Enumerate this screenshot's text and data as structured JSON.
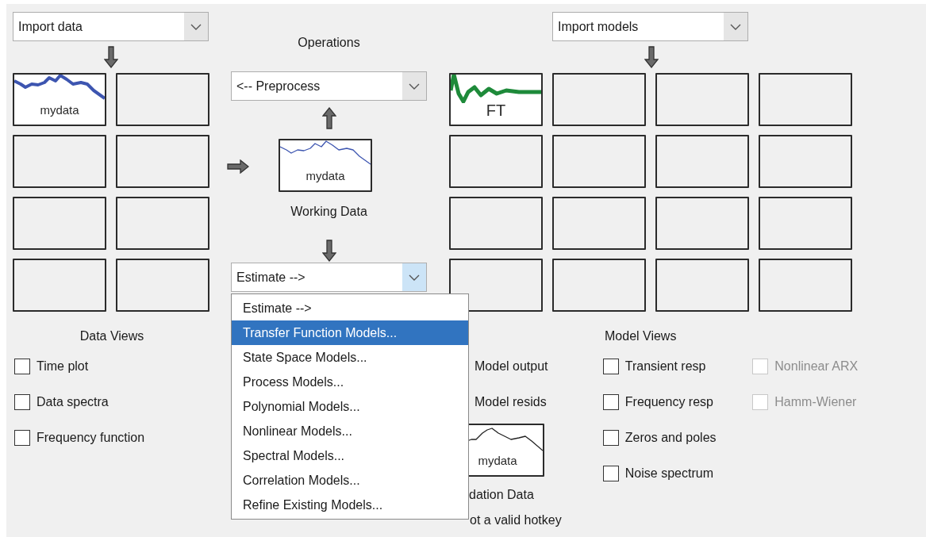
{
  "data_panel": {
    "import_dropdown": "Import data",
    "tiles": [
      {
        "kind": "data",
        "label": "mydata"
      },
      {
        "kind": "empty"
      },
      {
        "kind": "empty"
      },
      {
        "kind": "empty"
      },
      {
        "kind": "empty"
      },
      {
        "kind": "empty"
      },
      {
        "kind": "empty"
      },
      {
        "kind": "empty"
      }
    ],
    "views_title": "Data Views",
    "views": [
      {
        "label": "Time plot",
        "checked": false
      },
      {
        "label": "Data spectra",
        "checked": false
      },
      {
        "label": "Frequency function",
        "checked": false
      }
    ]
  },
  "operations": {
    "title": "Operations",
    "preprocess": "<-- Preprocess",
    "working_data": {
      "label": "mydata",
      "caption": "Working Data"
    },
    "estimate": {
      "value": "Estimate -->",
      "open": true,
      "options": [
        {
          "label": "Estimate -->",
          "highlighted": false
        },
        {
          "label": "Transfer Function Models...",
          "highlighted": true
        },
        {
          "label": "State Space Models...",
          "highlighted": false
        },
        {
          "label": "Process Models...",
          "highlighted": false
        },
        {
          "label": "Polynomial Models...",
          "highlighted": false
        },
        {
          "label": "Nonlinear Models...",
          "highlighted": false
        },
        {
          "label": "Spectral Models...",
          "highlighted": false
        },
        {
          "label": "Correlation Models...",
          "highlighted": false
        },
        {
          "label": "Refine Existing Models...",
          "highlighted": false
        }
      ]
    }
  },
  "model_panel": {
    "import_dropdown": "Import models",
    "tiles": [
      {
        "kind": "model",
        "label": "FT"
      },
      {
        "kind": "empty"
      },
      {
        "kind": "empty"
      },
      {
        "kind": "empty"
      },
      {
        "kind": "empty"
      },
      {
        "kind": "empty"
      },
      {
        "kind": "empty"
      },
      {
        "kind": "empty"
      },
      {
        "kind": "empty"
      },
      {
        "kind": "empty"
      },
      {
        "kind": "empty"
      },
      {
        "kind": "empty"
      },
      {
        "kind": "empty"
      },
      {
        "kind": "empty"
      },
      {
        "kind": "empty"
      },
      {
        "kind": "empty"
      }
    ],
    "validation": {
      "checks": [
        {
          "label": "Model output"
        },
        {
          "label": "Model resids"
        }
      ],
      "tile_label": "mydata",
      "caption": "dation Data",
      "note": "ot a valid hotkey"
    },
    "views_title": "Model Views",
    "views": [
      {
        "label": "Transient resp",
        "checked": false,
        "disabled": false
      },
      {
        "label": "Frequency resp",
        "checked": false,
        "disabled": false
      },
      {
        "label": "Zeros and poles",
        "checked": false,
        "disabled": false
      },
      {
        "label": "Noise spectrum",
        "checked": false,
        "disabled": false
      }
    ],
    "extra_views": [
      {
        "label": "Nonlinear ARX",
        "checked": false,
        "disabled": true
      },
      {
        "label": "Hamm-Wiener",
        "checked": false,
        "disabled": true
      }
    ]
  }
}
